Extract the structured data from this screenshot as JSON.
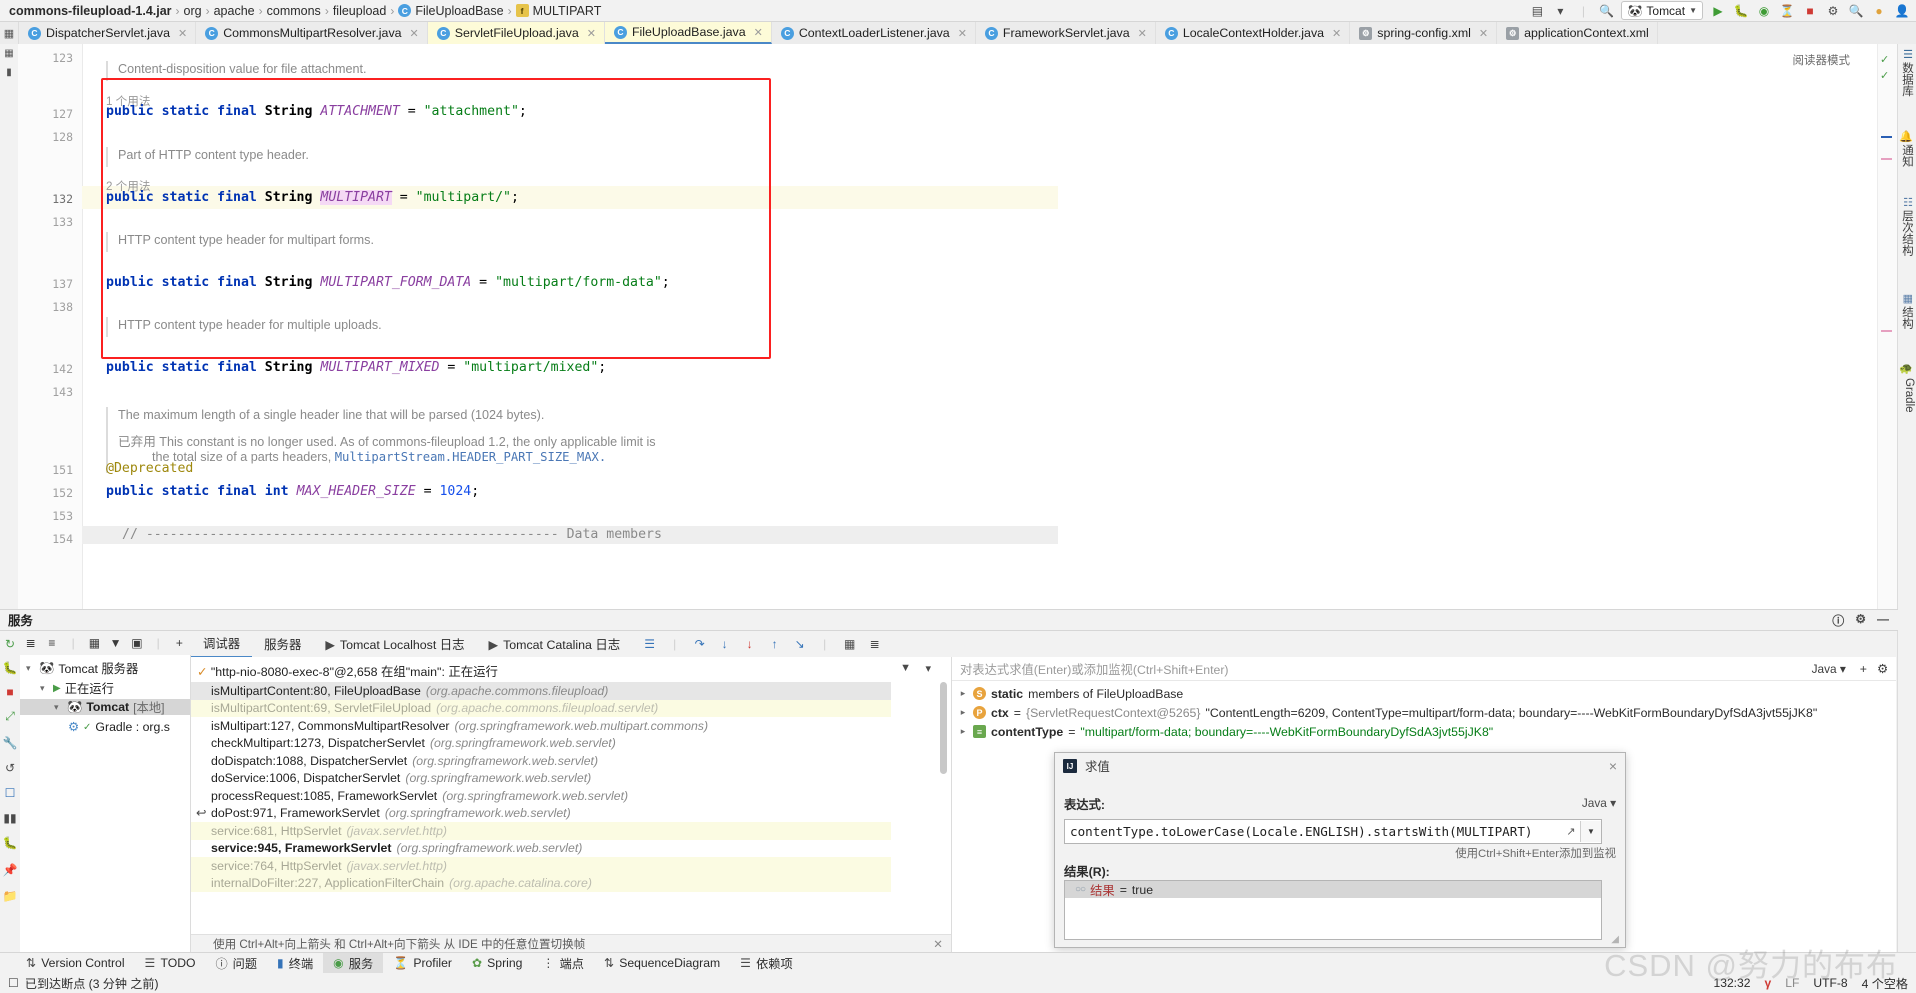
{
  "breadcrumb": {
    "items": [
      {
        "label": "commons-fileupload-1.4.jar",
        "icon": "jar-icon",
        "bold": true
      },
      {
        "label": "org",
        "icon": "package-icon"
      },
      {
        "label": "apache",
        "icon": "package-icon"
      },
      {
        "label": "commons",
        "icon": "package-icon"
      },
      {
        "label": "fileupload",
        "icon": "package-icon"
      },
      {
        "label": "FileUploadBase",
        "icon": "class-icon"
      },
      {
        "label": "MULTIPART",
        "icon": "field-icon"
      }
    ],
    "separator": "›"
  },
  "toolbar": {
    "run_config": "Tomcat",
    "icons": [
      "layout-icon",
      "search-everywhere-icon",
      "run-icon",
      "debug-icon",
      "coverage-icon",
      "profiler-icon",
      "stop-icon",
      "settings-icon",
      "search-icon",
      "notifications-icon",
      "account-icon"
    ]
  },
  "tabs": [
    {
      "label": "DispatcherServlet.java",
      "icon": "java-class-icon",
      "state": "normal"
    },
    {
      "label": "CommonsMultipartResolver.java",
      "icon": "java-class-icon",
      "state": "normal"
    },
    {
      "label": "ServletFileUpload.java",
      "icon": "java-class-icon",
      "state": "selected"
    },
    {
      "label": "FileUploadBase.java",
      "icon": "java-class-icon",
      "state": "active"
    },
    {
      "label": "ContextLoaderListener.java",
      "icon": "java-class-icon",
      "state": "normal"
    },
    {
      "label": "FrameworkServlet.java",
      "icon": "java-class-icon",
      "state": "normal"
    },
    {
      "label": "LocaleContextHolder.java",
      "icon": "java-class-icon",
      "state": "normal"
    },
    {
      "label": "spring-config.xml",
      "icon": "xml-icon",
      "state": "normal"
    },
    {
      "label": "applicationContext.xml",
      "icon": "xml-icon",
      "state": "normal"
    }
  ],
  "editor": {
    "reader_mode_label": "阅读器模式",
    "line_numbers": [
      "123",
      "127",
      "128",
      "132",
      "133",
      "137",
      "138",
      "142",
      "143",
      "151",
      "152",
      "153",
      "154"
    ],
    "docs": {
      "d1": "Content-disposition value for file attachment.",
      "d2": "Part of HTTP content type header.",
      "d3": "HTTP content type header for multipart forms.",
      "d4": "HTTP content type header for multiple uploads.",
      "d5": "The maximum length of a single header line that will be parsed (1024 bytes).",
      "d6_tag": "已弃用",
      "d6": " This constant is no longer used. As of commons-fileupload 1.2, the only applicable limit is",
      "d7": "the total size of a parts headers, ",
      "d7_link": "MultipartStream.HEADER_PART_SIZE_MAX."
    },
    "usages": {
      "u1": "1 个用法",
      "u2": "2 个用法"
    },
    "code": {
      "attachment": {
        "mods": "public static final ",
        "type": "String ",
        "name": "ATTACHMENT",
        "eq": " = ",
        "val": "\"attachment\"",
        "semi": ";"
      },
      "multipart": {
        "mods": "public static final ",
        "type": "String ",
        "name": "MULTIPART",
        "eq": " = ",
        "val": "\"multipart/\"",
        "semi": ";"
      },
      "multipart_form_data": {
        "mods": "public static final ",
        "type": "String ",
        "name": "MULTIPART_FORM_DATA",
        "eq": " = ",
        "val": "\"multipart/form-data\"",
        "semi": ";"
      },
      "multipart_mixed": {
        "mods": "public static final ",
        "type": "String ",
        "name": "MULTIPART_MIXED",
        "eq": " = ",
        "val": "\"multipart/mixed\"",
        "semi": ";"
      },
      "deprecated_ann": "@Deprecated",
      "max_header": {
        "mods": "public static final ",
        "type": "int ",
        "name": "MAX_HEADER_SIZE",
        "eq": " = ",
        "val": "1024",
        "semi": ";"
      },
      "data_members": "// ---------------------------------------------------- Data members"
    },
    "highlight_box_color": "#fb2020"
  },
  "right_tool_strip": [
    {
      "label": "数据库",
      "icon": "database-icon"
    },
    {
      "label": "通知",
      "icon": "bell-icon"
    },
    {
      "label": "层次结构",
      "icon": "hierarchy-icon"
    },
    {
      "label": "结构",
      "icon": "structure-icon"
    },
    {
      "label": "Gradle",
      "icon": "gradle-icon"
    }
  ],
  "services": {
    "title": "服务",
    "toolbar_icons": [
      "expand-all-icon",
      "collapse-all-icon",
      "group-icon",
      "filter-icon",
      "show-icon",
      "add-icon"
    ],
    "left_icons": [
      "rerun-icon",
      "debug-icon",
      "stop-icon",
      "redeploy-icon",
      "settings-icon",
      "restart-icon",
      "help-icon",
      "pause-icon",
      "bug-icon",
      "pin-icon",
      "export-icon"
    ],
    "tree": [
      {
        "label": "Tomcat 服务器",
        "icon": "tomcat-icon",
        "indent": 0,
        "expanded": true,
        "selected": false,
        "bold": false
      },
      {
        "label": "正在运行",
        "icon": "run-icon",
        "indent": 1,
        "expanded": true,
        "selected": false,
        "bold": false
      },
      {
        "label": "Tomcat",
        "suffix": "[本地]",
        "icon": "tomcat-icon",
        "indent": 2,
        "expanded": true,
        "selected": true,
        "bold": true
      },
      {
        "label": "Gradle : org.s",
        "icon": "gradle-artifact-icon",
        "indent": 3,
        "expanded": false,
        "selected": false,
        "bold": false
      }
    ]
  },
  "debugger": {
    "tabs": [
      {
        "label": "调试器",
        "active": true
      },
      {
        "label": "服务器",
        "active": false
      },
      {
        "label": "Tomcat Localhost 日志",
        "active": false,
        "icon": "console-icon"
      },
      {
        "label": "Tomcat Catalina 日志",
        "active": false,
        "icon": "console-icon"
      }
    ],
    "action_icons": [
      "layout-icon",
      "step-over-icon",
      "step-into-icon",
      "force-step-into-icon",
      "step-out-icon",
      "run-to-cursor-icon",
      "evaluate-icon",
      "settings-icon"
    ],
    "thread": "\"http-nio-8080-exec-8\"@2,658 在组\"main\": 正在运行",
    "thread_filter_icon": "filter-icon",
    "frames": [
      {
        "method": "isMultipartContent:80, FileUploadBase",
        "pkg": "(org.apache.commons.fileupload)",
        "hl": "grey"
      },
      {
        "method": "isMultipartContent:69, ServletFileUpload",
        "pkg": "(org.apache.commons.fileupload.servlet)",
        "hl": "yellow-dim"
      },
      {
        "method": "isMultipart:127, CommonsMultipartResolver",
        "pkg": "(org.springframework.web.multipart.commons)",
        "hl": "none"
      },
      {
        "method": "checkMultipart:1273, DispatcherServlet",
        "pkg": "(org.springframework.web.servlet)",
        "hl": "none"
      },
      {
        "method": "doDispatch:1088, DispatcherServlet",
        "pkg": "(org.springframework.web.servlet)",
        "hl": "none"
      },
      {
        "method": "doService:1006, DispatcherServlet",
        "pkg": "(org.springframework.web.servlet)",
        "hl": "none"
      },
      {
        "method": "processRequest:1085, FrameworkServlet",
        "pkg": "(org.springframework.web.servlet)",
        "hl": "none"
      },
      {
        "method": "doPost:971, FrameworkServlet",
        "pkg": "(org.springframework.web.servlet)",
        "hl": "none",
        "marker": "↩"
      },
      {
        "method": "service:681, HttpServlet",
        "pkg": "(javax.servlet.http)",
        "hl": "yellow-dim"
      },
      {
        "method": "service:945, FrameworkServlet",
        "pkg": "(org.springframework.web.servlet)",
        "hl": "none",
        "bold": true
      },
      {
        "method": "service:764, HttpServlet",
        "pkg": "(javax.servlet.http)",
        "hl": "yellow-dim"
      },
      {
        "method": "internalDoFilter:227, ApplicationFilterChain",
        "pkg": "(org.apache.catalina.core)",
        "hl": "yellow-dim"
      }
    ],
    "hint": "使用 Ctrl+Alt+向上箭头 和 Ctrl+Alt+向下箭头 从 IDE 中的任意位置切换帧"
  },
  "variables": {
    "placeholder": "对表达式求值(Enter)或添加监视(Ctrl+Shift+Enter)",
    "language": "Java",
    "rows": [
      {
        "badge": "S",
        "badge_kind": "static",
        "kw": "static",
        "text": " members of FileUploadBase"
      },
      {
        "badge": "P",
        "badge_kind": "param",
        "name": "ctx",
        "eq": " = ",
        "objid": "{ServletRequestContext@5265}",
        "value": "\"ContentLength=6209, ContentType=multipart/form-data; boundary=----WebKitFormBoundaryDyfSdA3jvt55jJK8\""
      },
      {
        "badge": "≡",
        "badge_kind": "local",
        "name": "contentType",
        "eq": " = ",
        "value": "\"multipart/form-data; boundary=----WebKitFormBoundaryDyfSdA3jvt55jJK8\""
      }
    ]
  },
  "evaluate_dialog": {
    "title": "求值",
    "expression_label": "表达式:",
    "language": "Java",
    "expression": "contentType.toLowerCase(Locale.ENGLISH).startsWith(MULTIPART)",
    "hint": "使用Ctrl+Shift+Enter添加到监视",
    "result_label": "结果(R):",
    "result_name": "结果",
    "result_eq": " = ",
    "result_value": "true",
    "close_label": "×"
  },
  "bottom_tools": [
    {
      "label": "Version Control",
      "icon": "vcs-icon",
      "active": false
    },
    {
      "label": "TODO",
      "icon": "todo-icon",
      "active": false
    },
    {
      "label": "问题",
      "icon": "problems-icon",
      "active": false
    },
    {
      "label": "终端",
      "icon": "terminal-icon",
      "active": false
    },
    {
      "label": "服务",
      "icon": "services-icon",
      "active": true
    },
    {
      "label": "Profiler",
      "icon": "profiler-icon",
      "active": false
    },
    {
      "label": "Spring",
      "icon": "spring-icon",
      "active": false
    },
    {
      "label": "端点",
      "icon": "endpoints-icon",
      "active": false
    },
    {
      "label": "SequenceDiagram",
      "icon": "sequence-icon",
      "active": false
    },
    {
      "label": "依赖项",
      "icon": "dependencies-icon",
      "active": false
    }
  ],
  "status_bar": {
    "message": "已到达断点 (3 分钟 之前)",
    "caret": "132:32",
    "git_branch": "γ",
    "line_sep": "LF",
    "encoding": "UTF-8",
    "indent": "4 个空格"
  },
  "watermark": "CSDN @努力的布布"
}
